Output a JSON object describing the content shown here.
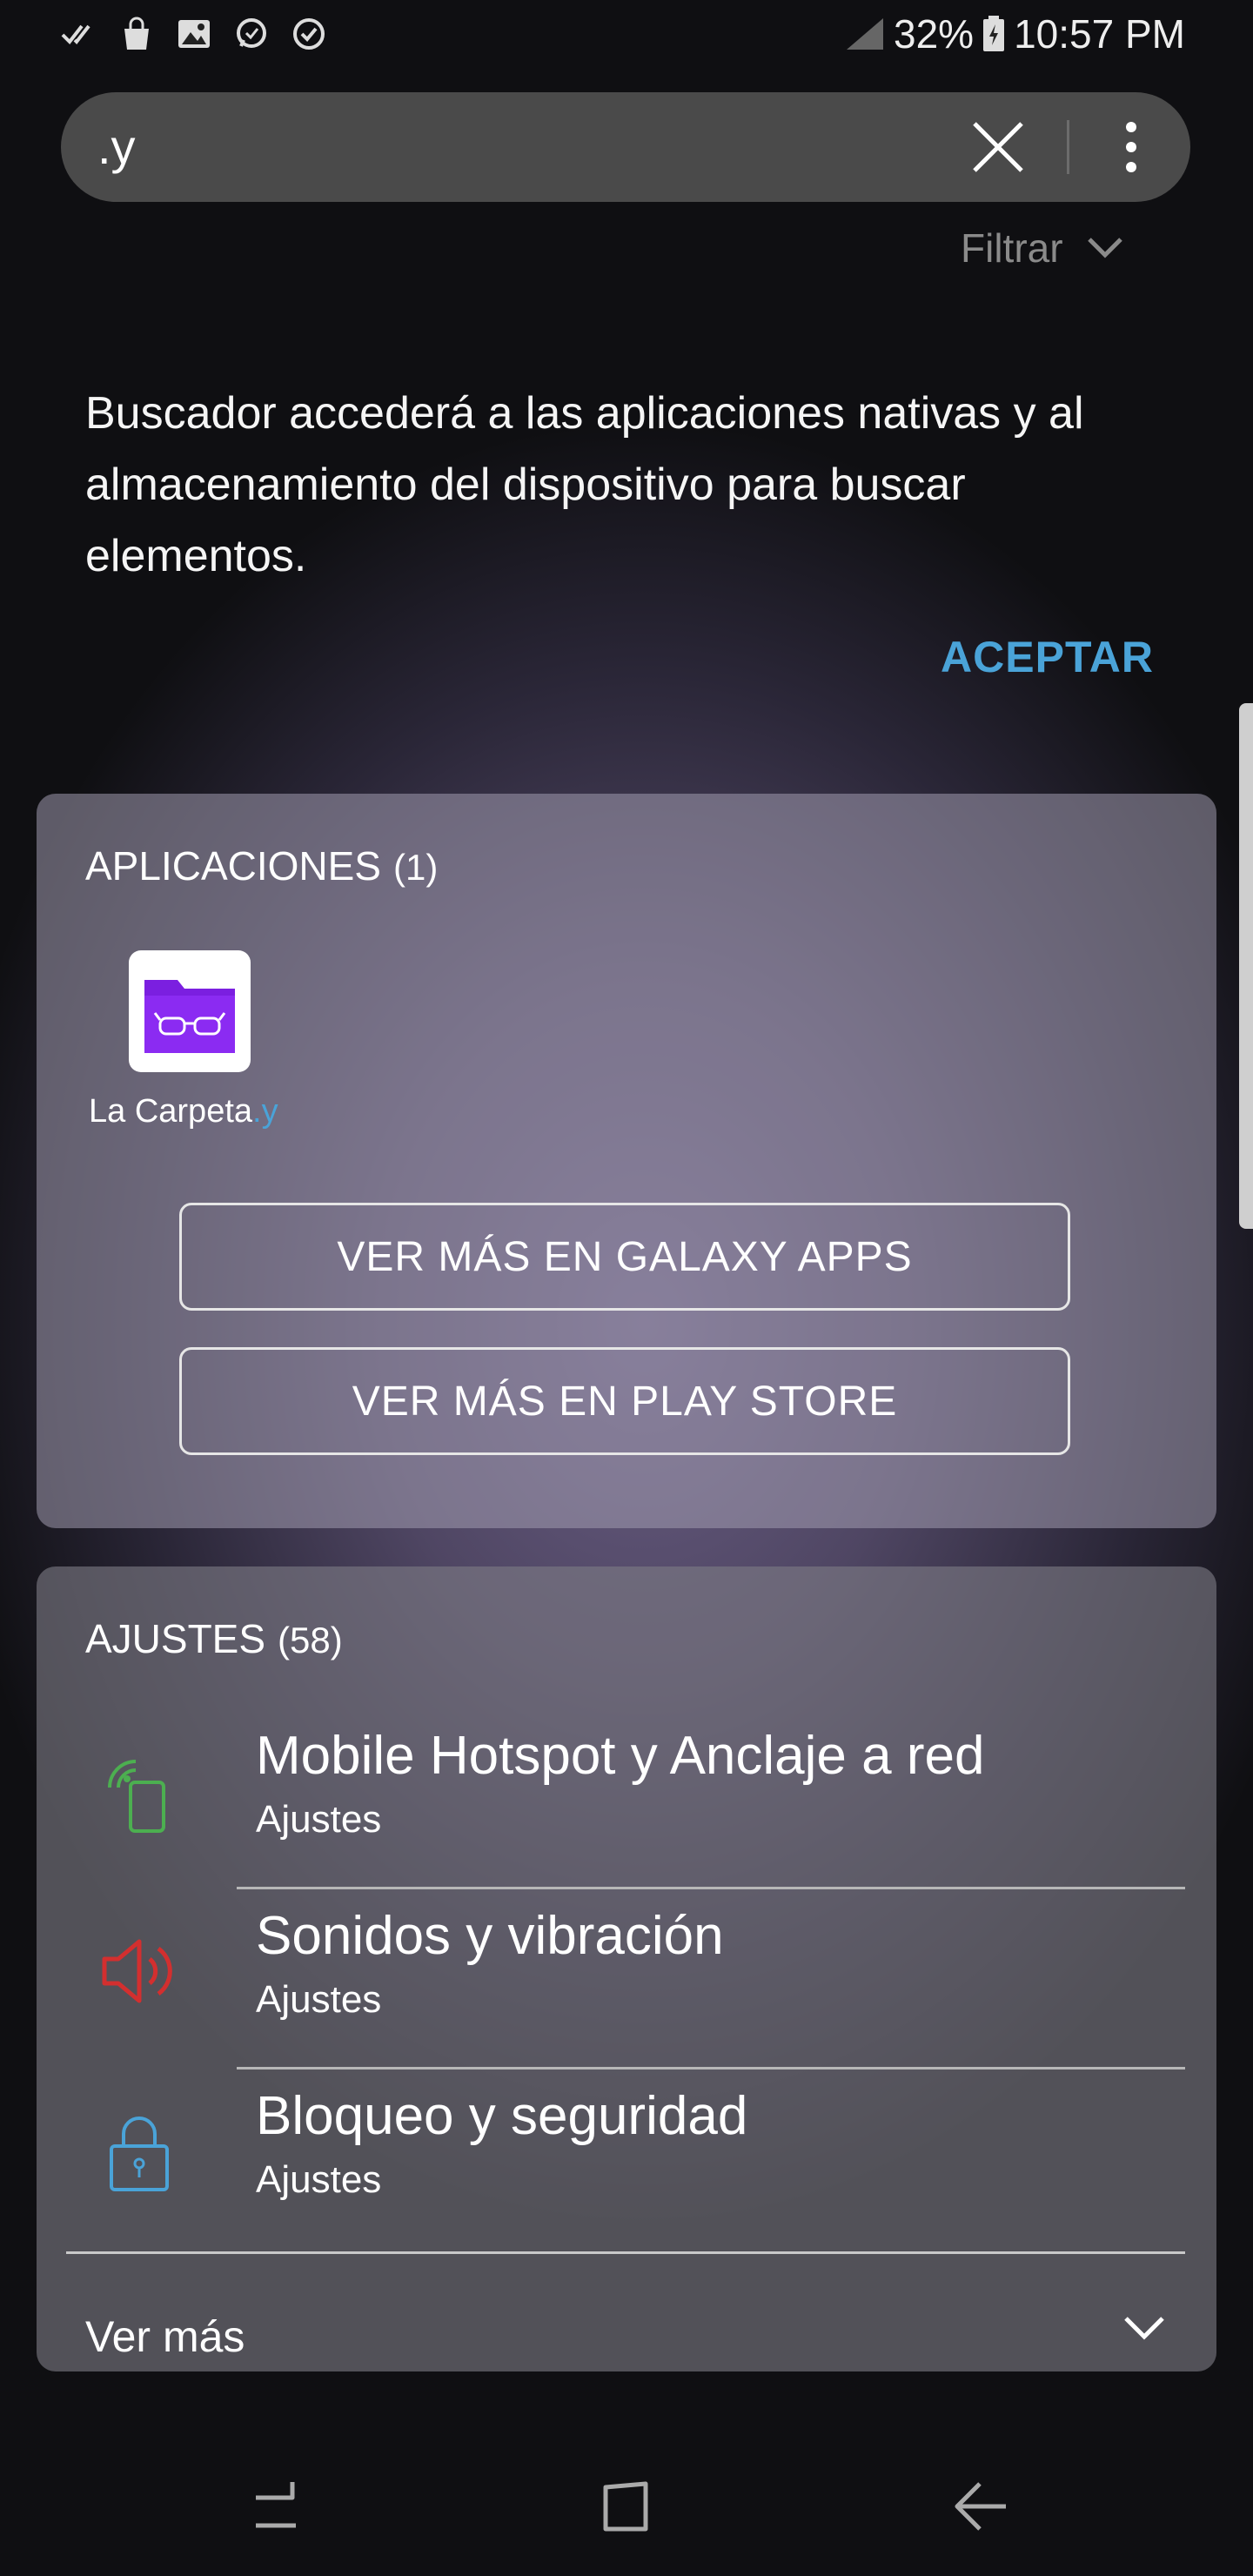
{
  "status_bar": {
    "battery": "32%",
    "time": "10:57 PM",
    "icons": [
      "double-check-icon",
      "shopping-bag-icon",
      "gallery-icon",
      "whatsapp-icon",
      "check-circle-icon",
      "signal-icon",
      "battery-icon"
    ]
  },
  "search": {
    "query": ".y",
    "clear_icon": "close-icon",
    "more_icon": "more-vert-icon"
  },
  "filter": {
    "label": "Filtrar"
  },
  "consent": {
    "message": "Buscador accederá a las aplicaciones nativas y al almacenamiento del dispositivo para buscar elementos.",
    "accept_label": "ACEPTAR"
  },
  "apps_section": {
    "title": "APLICACIONES",
    "count": "(1)",
    "apps": [
      {
        "name_prefix": "La Carpeta",
        "name_highlight": ".y",
        "icon": "folder-glasses-icon"
      }
    ],
    "galaxy_button": "VER MÁS EN GALAXY APPS",
    "play_button": "VER MÁS EN PLAY STORE"
  },
  "settings_section": {
    "title": "AJUSTES",
    "count": "(58)",
    "items": [
      {
        "title": "Mobile Hotspot y Anclaje a red",
        "subtitle": "Ajustes",
        "icon": "hotspot-icon"
      },
      {
        "title": "Sonidos y vibración",
        "subtitle": "Ajustes",
        "icon": "speaker-icon"
      },
      {
        "title": "Bloqueo y seguridad",
        "subtitle": "Ajustes",
        "icon": "lock-icon"
      }
    ],
    "see_more": "Ver más"
  },
  "nav_bar": {
    "buttons": [
      "recents-icon",
      "home-icon",
      "back-icon"
    ]
  },
  "colors": {
    "accent": "#4aa3d8",
    "hotspot_green": "#4caf50",
    "sound_red": "#d32f2f",
    "lock_blue": "#4aa3d8",
    "app_purple": "#7b1fe0"
  }
}
